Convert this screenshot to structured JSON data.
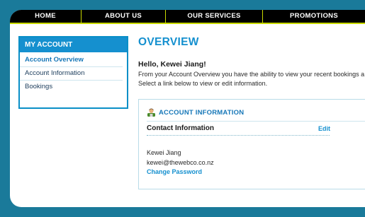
{
  "nav": {
    "items": [
      {
        "label": "HOME"
      },
      {
        "label": "ABOUT US"
      },
      {
        "label": "OUR SERVICES"
      },
      {
        "label": "PROMOTIONS"
      }
    ]
  },
  "sidebar": {
    "title": "MY ACCOUNT",
    "items": [
      {
        "label": "Account Overview"
      },
      {
        "label": "Account Information"
      },
      {
        "label": "Bookings"
      }
    ]
  },
  "main": {
    "title": "OVERVIEW",
    "greeting": "Hello, Kewei Jiang!",
    "intro_line1": "From your Account Overview you have the ability to view your recent bookings a",
    "intro_line2": "Select a link below to view or edit information."
  },
  "account_info": {
    "heading": "ACCOUNT INFORMATION",
    "contact_label": "Contact Information",
    "edit_label": "Edit",
    "name": "Kewei Jiang",
    "email": "kewei@thewebco.co.nz",
    "change_password_label": "Change Password"
  },
  "colors": {
    "background": "#1a7a9a",
    "accent": "#1590cf",
    "nav_bg": "#000000",
    "nav_divider": "#c8d800"
  }
}
